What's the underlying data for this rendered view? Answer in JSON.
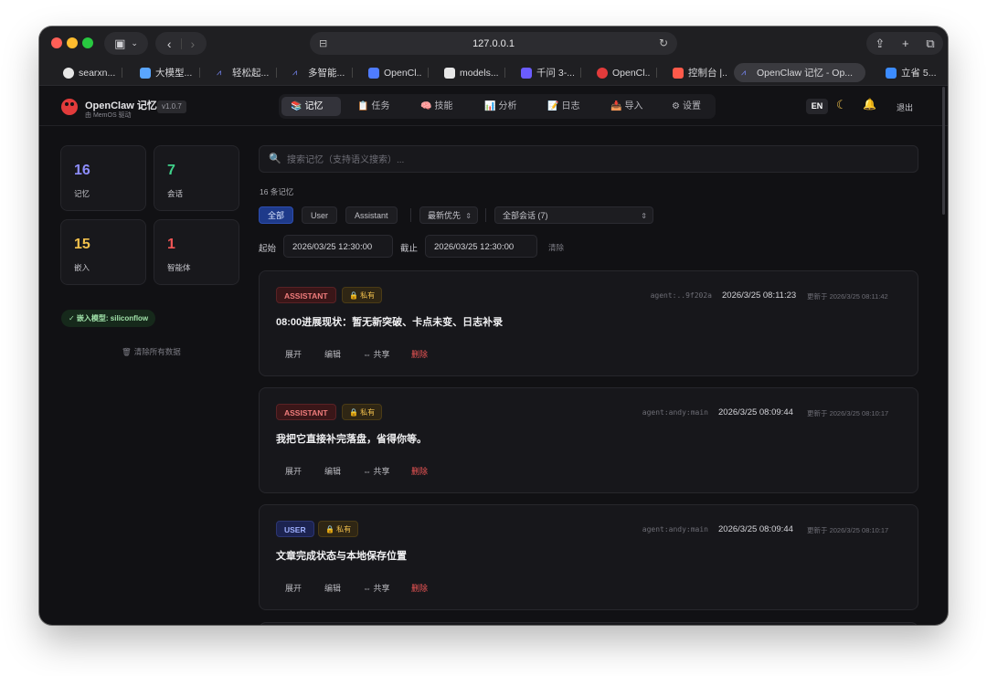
{
  "browser": {
    "url": "127.0.0.1",
    "tabs": [
      {
        "label": "searxn...",
        "color": "#e7e7e7"
      },
      {
        "label": "大模型...",
        "color": "#5aa6ff"
      },
      {
        "label": "轻松起...",
        "color": "#7b8cff"
      },
      {
        "label": "多智能...",
        "color": "#7b8cff"
      },
      {
        "label": "OpenCl...",
        "color": "#4f7cff"
      },
      {
        "label": "models...",
        "color": "#e7e7e7"
      },
      {
        "label": "千问 3-...",
        "color": "#6b5cff"
      },
      {
        "label": "OpenCl...",
        "color": "#e23b3b"
      },
      {
        "label": "控制台 |...",
        "color": "#ff5a4a"
      },
      {
        "label": "OpenClaw 记忆 - Op...",
        "color": "#7b8cff"
      },
      {
        "label": "立省 5...",
        "color": "#3c8cff"
      }
    ]
  },
  "app": {
    "brand_title": "OpenClaw 记忆",
    "brand_sub": "由 MemOS 驱动",
    "version": "v1.0.7",
    "nav": [
      {
        "icon": "📚",
        "label": "记忆"
      },
      {
        "icon": "📋",
        "label": "任务"
      },
      {
        "icon": "🧠",
        "label": "技能"
      },
      {
        "icon": "📊",
        "label": "分析"
      },
      {
        "icon": "📝",
        "label": "日志"
      },
      {
        "icon": "📥",
        "label": "导入"
      },
      {
        "icon": "⚙",
        "label": "设置"
      }
    ],
    "lang": "EN",
    "logout": "退出"
  },
  "sidebar": {
    "stats": [
      {
        "value": "16",
        "label": "记忆",
        "color": "#8d8dff"
      },
      {
        "value": "7",
        "label": "会话",
        "color": "#3fd18a"
      },
      {
        "value": "15",
        "label": "嵌入",
        "color": "#f2c04c"
      },
      {
        "value": "1",
        "label": "智能体",
        "color": "#f05656"
      }
    ],
    "embed_model": "✓ 嵌入模型: siliconflow",
    "clear_all": "清除所有数据"
  },
  "main": {
    "search_placeholder": "搜索记忆（支持语义搜索）...",
    "count": "16 条记忆",
    "filters": [
      "全部",
      "User",
      "Assistant"
    ],
    "sort": "最新优先",
    "session": "全部会话 (7)",
    "from_label": "起始",
    "from_value": "2026/03/25 12:30:00",
    "to_label": "截止",
    "to_value": "2026/03/25 12:30:00",
    "clear": "清除"
  },
  "memories": [
    {
      "role": "ASSISTANT",
      "privacy": "🔒 私有",
      "agent": "agent:..9f202a",
      "created": "2026/3/25 08:11:23",
      "updated": "更新于 2026/3/25 08:11:42",
      "title": "08:00进展现状：暂无新突破、卡点未变、日志补录"
    },
    {
      "role": "ASSISTANT",
      "privacy": "🔒 私有",
      "agent": "agent:andy:main",
      "created": "2026/3/25 08:09:44",
      "updated": "更新于 2026/3/25 08:10:17",
      "title": "我把它直接补完落盘，省得你等。"
    },
    {
      "role": "USER",
      "privacy": "🔒 私有",
      "agent": "agent:andy:main",
      "created": "2026/3/25 08:09:44",
      "updated": "更新于 2026/3/25 08:10:17",
      "title": "文章完成状态与本地保存位置"
    }
  ],
  "actions": {
    "expand": "展开",
    "edit": "编辑",
    "share": "⇔ 共享",
    "delete": "删除"
  }
}
